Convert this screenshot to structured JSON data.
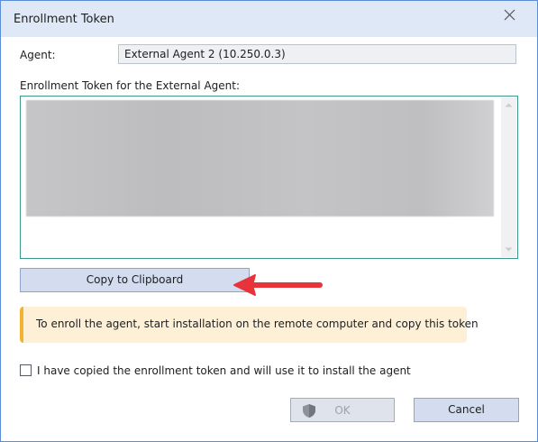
{
  "dialog": {
    "title": "Enrollment Token",
    "close_icon": "close-icon"
  },
  "agent": {
    "label": "Agent:",
    "value": "External Agent 2 (10.250.0.3)"
  },
  "token": {
    "label": "Enrollment Token for the External Agent:",
    "state": "blurred"
  },
  "buttons": {
    "copy_label": "Copy to Clipboard",
    "ok_label": "OK",
    "ok_enabled": false,
    "ok_icon": "shield-icon",
    "cancel_label": "Cancel"
  },
  "info": {
    "text": "To enroll the agent, start installation on the remote computer and copy this token",
    "accent_color": "#f2b430",
    "background_color": "#fdf0d6"
  },
  "confirm": {
    "label": "I have copied the enrollment token and will use it to install the agent",
    "checked": false
  },
  "annotation": {
    "icon": "red-arrow-icon",
    "color": "#e8333a"
  },
  "colors": {
    "titlebar": "#dfe8f6",
    "border": "#5b8ed6",
    "button": "#d4dcf0"
  }
}
